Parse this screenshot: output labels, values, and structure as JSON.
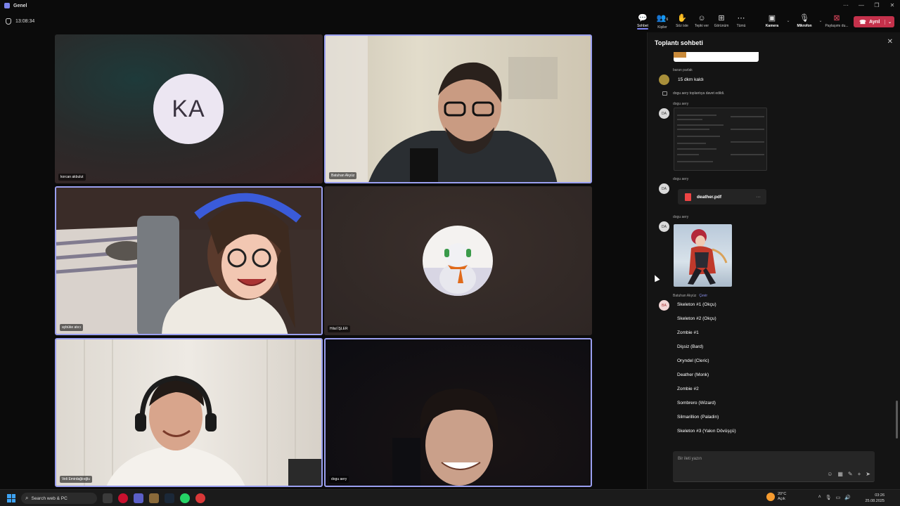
{
  "window": {
    "title": "Genel",
    "controls": [
      "⋯",
      "—",
      "❐",
      "✕"
    ]
  },
  "meeting": {
    "elapsed": "13:08:34"
  },
  "toolbar": {
    "items": [
      {
        "label": "Sohbet",
        "icon": "chat-icon",
        "glyph": "💬"
      },
      {
        "label": "Kişiler",
        "icon": "people-icon",
        "glyph": "👥",
        "count": "6"
      },
      {
        "label": "Söz iste",
        "icon": "raise-hand-icon",
        "glyph": "✋"
      },
      {
        "label": "Tepki ver",
        "icon": "react-icon",
        "glyph": "☺"
      },
      {
        "label": "Görünüm",
        "icon": "view-icon",
        "glyph": "⊞"
      },
      {
        "label": "Tümü",
        "icon": "more-icon",
        "glyph": "⋯"
      },
      {
        "label": "Kamera",
        "icon": "camera-icon",
        "glyph": "▣"
      },
      {
        "label": "Mikrofon",
        "icon": "mic-icon",
        "glyph": "🎙"
      },
      {
        "label": "Paylaşımı du...",
        "icon": "share-stop-icon",
        "glyph": "⊠"
      }
    ],
    "leave_label": "Ayrıl",
    "leave_caret": "⌄",
    "caret": "⌄"
  },
  "participants": [
    {
      "name": "korcan akbulut",
      "initials": "KA"
    },
    {
      "name": "Batuhan Akyüz"
    },
    {
      "name": "aybüke atıcı"
    },
    {
      "name": "Hilal İŞLER"
    },
    {
      "name": "Veli Emirdağlıoğlu"
    },
    {
      "name": "dogu aery"
    }
  ],
  "chat": {
    "title": "Toplantı sohbeti",
    "close_glyph": "✕",
    "messages": {
      "m1_sender": "baran parlak",
      "m1_text": "15 dkm kaldı",
      "system_text": "dogu aery toplantıya davet edildi.",
      "m2_sender": "dogu aery",
      "m2_initials": "DA",
      "m3_sender": "dogu aery",
      "m3_initials": "DA",
      "file_name": "deather.pdf",
      "file_more": "···",
      "m4_sender": "dogu aery",
      "m4_initials": "DA",
      "m5_sender": "Batuhan Akyüz",
      "m5_translate": "Çevir",
      "m5_initials": "BA",
      "list": [
        "Skeleton #1 (Okçu)",
        "Skeleton #2 (Okçu)",
        "Zombie #1",
        "Dişsiz (Bard)",
        "Oryndel (Cleric)",
        "Deather (Monk)",
        "Zombie #2",
        "Sombrero (Wizard)",
        "Silmarillion (Paladin)",
        "Skeleton #3 (Yakın Dövüşçü)"
      ]
    },
    "composer_placeholder": "Bir ileti yazın",
    "composer_icons": [
      "☺",
      "▦",
      "✎",
      "+",
      "➤"
    ]
  },
  "taskbar": {
    "search_placeholder": "Search web & PC",
    "weather_temp": "20°C",
    "weather_desc": "Açık",
    "time": "03:26",
    "date": "25.08.2025",
    "tray_glyphs": [
      "˄",
      "🎙",
      "▭",
      "🔊"
    ]
  }
}
